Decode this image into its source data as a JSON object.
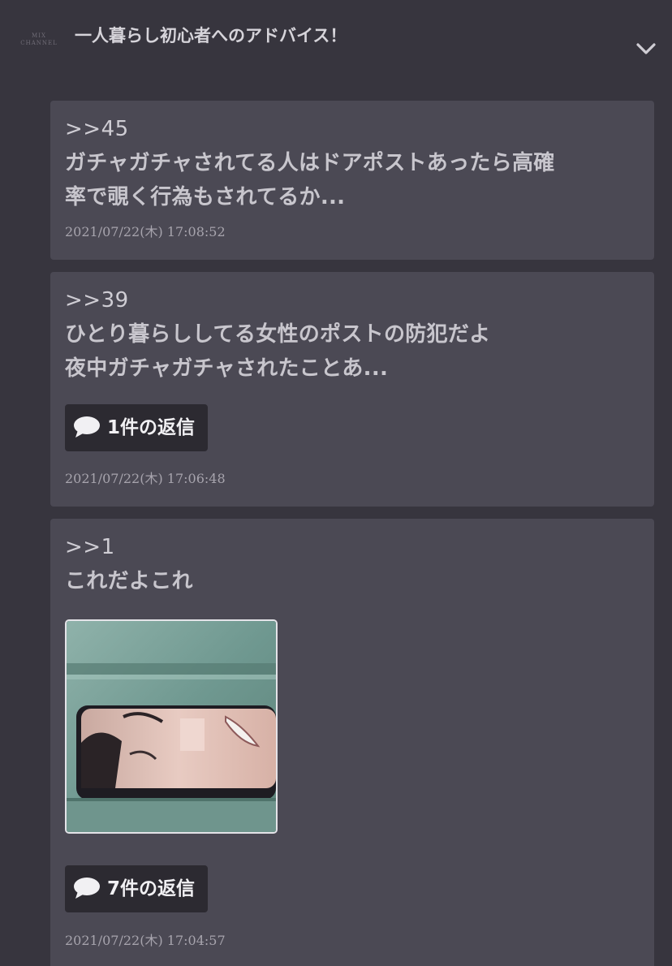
{
  "header": {
    "logo_text": [
      "MIX",
      "CHANNEL"
    ],
    "thread_title": "一人暮らし初心者へのアドバイス！",
    "collapse_icon": "chevron-down-icon"
  },
  "comments": [
    {
      "anchor": ">>45",
      "lines": [
        "ガチャガチャされてる人はドアポストあったら高確",
        "率で覗く行為もされてるか..."
      ],
      "reply_label": "",
      "timestamp": "2021/07/22(木) 17:08:52"
    },
    {
      "anchor": ">>39",
      "lines": [
        "ひとり暮らししてる女性のポストの防犯だよ",
        "夜中ガチャガチャされたことあ..."
      ],
      "reply_label": "1件の返信",
      "timestamp": "2021/07/22(木) 17:06:48"
    },
    {
      "anchor": ">>1",
      "lines": [
        "これだよこれ"
      ],
      "image": "mail-slot-face-photo",
      "reply_label": "7件の返信",
      "timestamp": "2021/07/22(木) 17:04:57"
    }
  ],
  "colors": {
    "background": "#37353e",
    "card": "#4b4954",
    "reply_button": "#2c2a31",
    "text": "#c8c6cd"
  }
}
